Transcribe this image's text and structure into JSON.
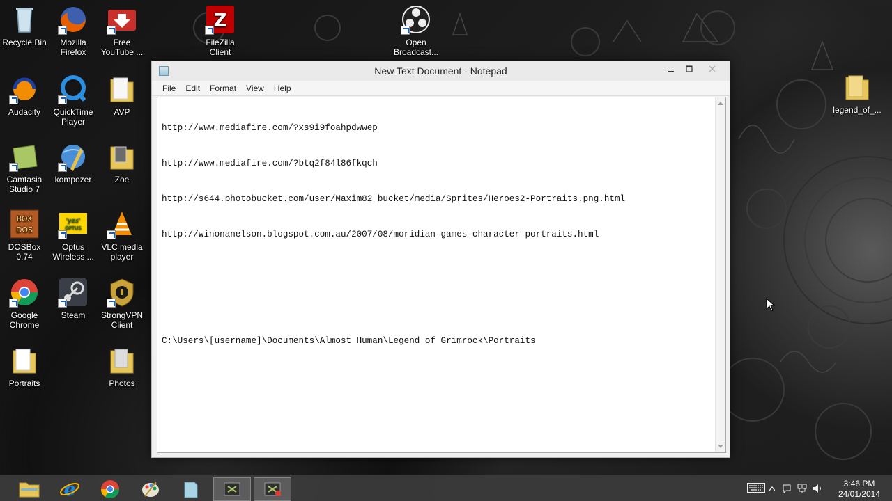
{
  "desktop": {
    "icons": [
      {
        "label": "Recycle Bin",
        "icon": "recycle-bin-icon"
      },
      {
        "label": "Mozilla Firefox",
        "icon": "firefox-icon"
      },
      {
        "label": "Free YouTube ...",
        "icon": "youtube-download-icon"
      },
      {
        "label": "FileZilla Client",
        "icon": "filezilla-icon"
      },
      {
        "label": "Open Broadcast...",
        "icon": "obs-icon"
      },
      {
        "label": "Audacity",
        "icon": "audacity-icon"
      },
      {
        "label": "QuickTime Player",
        "icon": "quicktime-icon"
      },
      {
        "label": "AVP",
        "icon": "folder-icon"
      },
      {
        "label": "legend_of_...",
        "icon": "folder-icon"
      },
      {
        "label": "Camtasia Studio 7",
        "icon": "camtasia-icon"
      },
      {
        "label": "kompozer",
        "icon": "kompozer-icon"
      },
      {
        "label": "Zoe",
        "icon": "folder-icon"
      },
      {
        "label": "DOSBox 0.74",
        "icon": "dosbox-icon"
      },
      {
        "label": "Optus Wireless ...",
        "icon": "optus-icon"
      },
      {
        "label": "VLC media player",
        "icon": "vlc-icon"
      },
      {
        "label": "Google Chrome",
        "icon": "chrome-icon"
      },
      {
        "label": "Steam",
        "icon": "steam-icon"
      },
      {
        "label": "StrongVPN Client",
        "icon": "strongvpn-icon"
      },
      {
        "label": "Portraits",
        "icon": "folder-icon"
      },
      {
        "label": "Photos",
        "icon": "folder-icon"
      }
    ]
  },
  "notepad": {
    "title": "New Text Document - Notepad",
    "menu": [
      "File",
      "Edit",
      "Format",
      "View",
      "Help"
    ],
    "lines": [
      "http://www.mediafire.com/?xs9i9foahpdwwep",
      "http://www.mediafire.com/?btq2f84l86fkqch",
      "http://s644.photobucket.com/user/Maxim82_bucket/media/Sprites/Heroes2-Portraits.png.html",
      "http://winonanelson.blogspot.com.au/2007/08/moridian-games-character-portraits.html",
      "",
      "",
      "C:\\Users\\[username]\\Documents\\Almost Human\\Legend of Grimrock\\Portraits"
    ]
  },
  "taskbar": {
    "apps": [
      "file-explorer-icon",
      "internet-explorer-icon",
      "chrome-icon",
      "paint-icon",
      "notepad-icon",
      "camtasia-recorder-icon",
      "camtasia-recording-icon"
    ],
    "clock_time": "3:46 PM",
    "clock_date": "24/01/2014"
  },
  "colors": {
    "accent_blue": "#1a5fb4",
    "folder_yellow": "#e8c75a"
  }
}
